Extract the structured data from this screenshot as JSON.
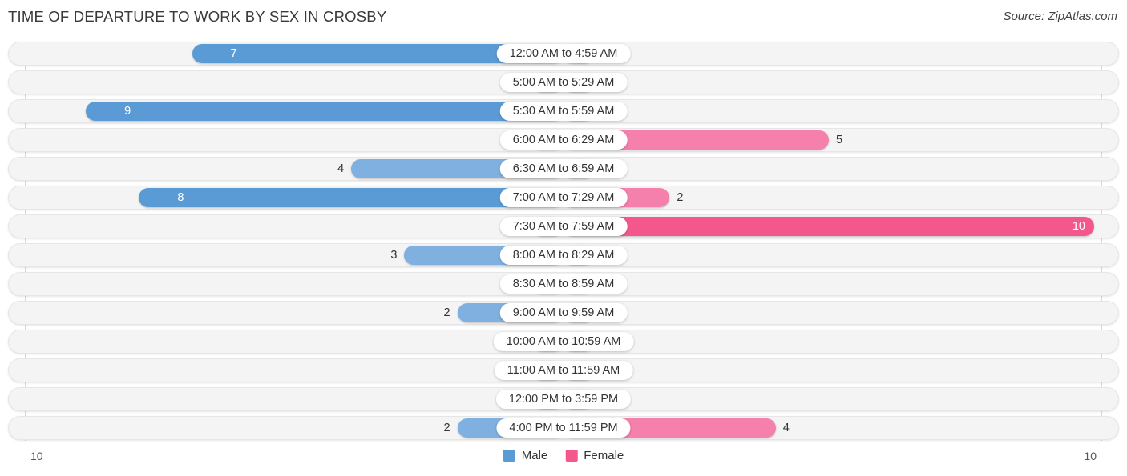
{
  "header": {
    "title": "TIME OF DEPARTURE TO WORK BY SEX IN CROSBY",
    "source": "Source: ZipAtlas.com"
  },
  "axis": {
    "left_tick": "10",
    "right_tick": "10"
  },
  "legend": {
    "items": [
      {
        "label": "Male",
        "color": "#5B9BD5"
      },
      {
        "label": "Female",
        "color": "#F4578C"
      }
    ]
  },
  "colors": {
    "male_light": "#A8C8EA",
    "male_mid": "#7FB0E0",
    "male_strong": "#5B9BD5",
    "female_light": "#F9A8C4",
    "female_mid": "#F580AC",
    "female_strong": "#F4578C",
    "track": "#f4f4f4",
    "pill": "#ffffff"
  },
  "chart_data": {
    "type": "bar",
    "title": "TIME OF DEPARTURE TO WORK BY SEX IN CROSBY",
    "orientation": "horizontal-diverging",
    "xlabel": "",
    "ylabel": "",
    "xlim": [
      10,
      10
    ],
    "grid": false,
    "legend_position": "bottom-center",
    "categories": [
      "12:00 AM to 4:59 AM",
      "5:00 AM to 5:29 AM",
      "5:30 AM to 5:59 AM",
      "6:00 AM to 6:29 AM",
      "6:30 AM to 6:59 AM",
      "7:00 AM to 7:29 AM",
      "7:30 AM to 7:59 AM",
      "8:00 AM to 8:29 AM",
      "8:30 AM to 8:59 AM",
      "9:00 AM to 9:59 AM",
      "10:00 AM to 10:59 AM",
      "11:00 AM to 11:59 AM",
      "12:00 PM to 3:59 PM",
      "4:00 PM to 11:59 PM"
    ],
    "series": [
      {
        "name": "Male",
        "values": [
          7,
          0,
          9,
          0,
          4,
          8,
          0,
          3,
          0,
          2,
          0,
          0,
          0,
          2
        ]
      },
      {
        "name": "Female",
        "values": [
          0,
          0,
          0,
          5,
          0,
          2,
          10,
          0,
          0,
          0,
          0,
          0,
          0,
          4
        ]
      }
    ]
  },
  "rows": [
    {
      "label": "12:00 AM to 4:59 AM",
      "male": "7",
      "female": "0"
    },
    {
      "label": "5:00 AM to 5:29 AM",
      "male": "0",
      "female": "0"
    },
    {
      "label": "5:30 AM to 5:59 AM",
      "male": "9",
      "female": "0"
    },
    {
      "label": "6:00 AM to 6:29 AM",
      "male": "0",
      "female": "5"
    },
    {
      "label": "6:30 AM to 6:59 AM",
      "male": "4",
      "female": "0"
    },
    {
      "label": "7:00 AM to 7:29 AM",
      "male": "8",
      "female": "2"
    },
    {
      "label": "7:30 AM to 7:59 AM",
      "male": "0",
      "female": "10"
    },
    {
      "label": "8:00 AM to 8:29 AM",
      "male": "3",
      "female": "0"
    },
    {
      "label": "8:30 AM to 8:59 AM",
      "male": "0",
      "female": "0"
    },
    {
      "label": "9:00 AM to 9:59 AM",
      "male": "2",
      "female": "0"
    },
    {
      "label": "10:00 AM to 10:59 AM",
      "male": "0",
      "female": "0"
    },
    {
      "label": "11:00 AM to 11:59 AM",
      "male": "0",
      "female": "0"
    },
    {
      "label": "12:00 PM to 3:59 PM",
      "male": "0",
      "female": "0"
    },
    {
      "label": "4:00 PM to 11:59 PM",
      "male": "2",
      "female": "4"
    }
  ]
}
